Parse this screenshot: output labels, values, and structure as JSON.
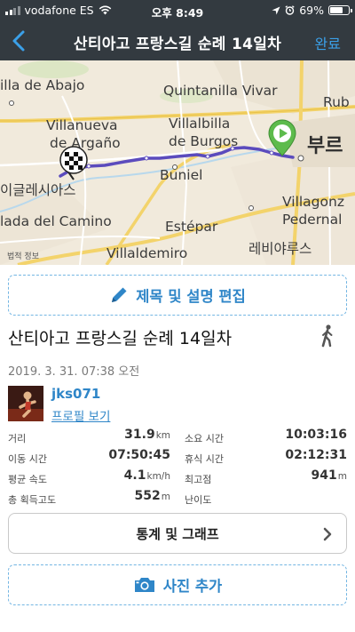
{
  "status_bar": {
    "carrier": "vodafone ES",
    "time": "오후 8:49",
    "battery": "69%",
    "battery_level": 0.69
  },
  "nav": {
    "title": "산티아고 프랑스길 순례 14일차",
    "done_label": "완료"
  },
  "map": {
    "labels": {
      "villa_de_abajo": "illa de Abajo",
      "quintanilla_vivar": "Quintanilla Vivar",
      "rub": "Rub",
      "villanueva": "Villanueva",
      "de_argano": "de Argaño",
      "villalbilla": "Villalbilla",
      "de_burgos": "de Burgos",
      "burgos_kr": "부르",
      "iglesias_kr": "이글레시아스",
      "buniel": "Buniel",
      "villagonz": "Villagonz",
      "pedernal": "Pedernal",
      "lada_del_camino": "lada del Camino",
      "estepar": "Estépar",
      "villaldemiro": "Villaldemiro",
      "revilla_kr": "레비야루스"
    },
    "legal": "법적 정보",
    "route_color": "#5b4bbd",
    "start_marker_color": "#5dbb4c"
  },
  "edit_button": {
    "label": "제목 및 설명 편집",
    "icon": "pencil-icon"
  },
  "trail": {
    "title": "산티아고 프랑스길 순례 14일차",
    "activity_icon": "walking-icon",
    "date": "2019. 3. 31. 07:38 오전"
  },
  "user": {
    "name": "jks071",
    "profile_link": "프로필 보기"
  },
  "stats": {
    "distance": {
      "label": "거리",
      "value": "31.9",
      "unit": "km"
    },
    "total_time": {
      "label": "소요 시간",
      "value": "10:03:16"
    },
    "moving_time": {
      "label": "이동 시간",
      "value": "07:50:45"
    },
    "rest_time": {
      "label": "휴식 시간",
      "value": "02:12:31"
    },
    "avg_speed": {
      "label": "평균 속도",
      "value": "4.1",
      "unit": "km/h"
    },
    "max_altitude": {
      "label": "최고점",
      "value": "941",
      "unit": "m"
    },
    "total_ascent": {
      "label": "총 획득고도",
      "value": "552",
      "unit": "m"
    },
    "difficulty": {
      "label": "난이도",
      "value": ""
    }
  },
  "stats_button": {
    "label": "통계 및 그래프",
    "icon": "chevron-right-icon"
  },
  "photo_button": {
    "label": "사진 추가",
    "icon": "camera-icon"
  },
  "colors": {
    "header_bg": "#333a40",
    "accent": "#2f86c8",
    "link": "#3ba0e8"
  }
}
